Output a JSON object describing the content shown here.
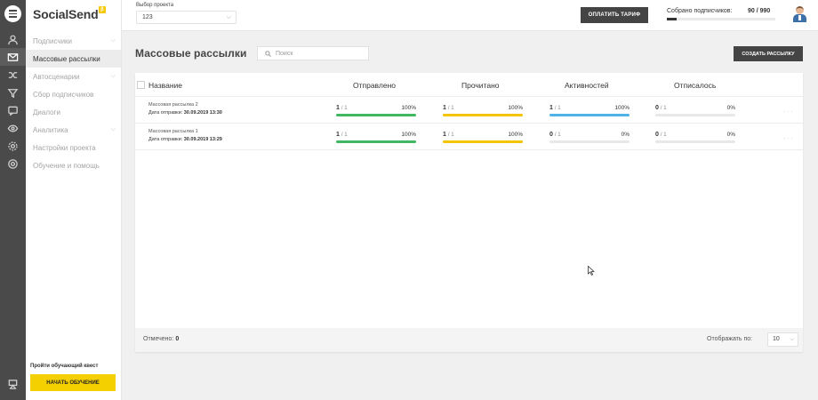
{
  "app": {
    "logo": "SocialSend",
    "logo_badge": "β"
  },
  "rail_icons": [
    "menu-icon",
    "users-icon",
    "mail-icon",
    "shuffle-icon",
    "funnel-icon",
    "chat-icon",
    "eye-icon",
    "gear-icon",
    "help-icon",
    "graduation-icon"
  ],
  "sidebar": {
    "items": [
      {
        "label": "Подписчики",
        "expandable": true
      },
      {
        "label": "Массовые рассылки",
        "active": true
      },
      {
        "label": "Автосценарии",
        "expandable": true
      },
      {
        "label": "Сбор подписчиков"
      },
      {
        "label": "Диалоги"
      },
      {
        "label": "Аналитика",
        "expandable": true
      },
      {
        "label": "Настройки проекта"
      },
      {
        "label": "Обучение и помощь"
      }
    ],
    "quest_label": "Пройти обучающий квест",
    "start_label": "НАЧАТЬ ОБУЧЕНИЕ"
  },
  "header": {
    "project_label": "Выбор проекта",
    "project_value": "123",
    "pay_label": "ОПЛАТИТЬ ТАРИФ",
    "subs_label": "Собрано подписчиков:",
    "subs_count": "90 / 990",
    "subs_progress": 0.09
  },
  "page": {
    "title": "Массовые рассылки",
    "search_placeholder": "Поиск",
    "create_label": "СОЗДАТЬ РАССЫЛКУ"
  },
  "table": {
    "columns": {
      "name": "Название",
      "sent": "Отправлено",
      "read": "Прочитано",
      "activity": "Активностей",
      "unsub": "Отписалось"
    },
    "rows": [
      {
        "name": "Массовая рассылка 2",
        "date_label": "Дата отправки:",
        "date": "30.09.2019 13:30",
        "sent": {
          "value": "1",
          "of": "/ 1",
          "pct": "100%",
          "fill": 1.0
        },
        "read": {
          "value": "1",
          "of": "/ 1",
          "pct": "100%",
          "fill": 1.0
        },
        "activity": {
          "value": "1",
          "of": "/ 1",
          "pct": "100%",
          "fill": 1.0
        },
        "unsub": {
          "value": "0",
          "of": "/ 1",
          "pct": "0%",
          "fill": 0.0
        }
      },
      {
        "name": "Массовая рассылка 1",
        "date_label": "Дата отправки:",
        "date": "30.09.2019 13:29",
        "sent": {
          "value": "1",
          "of": "/ 1",
          "pct": "100%",
          "fill": 1.0
        },
        "read": {
          "value": "1",
          "of": "/ 1",
          "pct": "100%",
          "fill": 1.0
        },
        "activity": {
          "value": "0",
          "of": "/ 1",
          "pct": "0%",
          "fill": 0.0
        },
        "unsub": {
          "value": "0",
          "of": "/ 1",
          "pct": "0%",
          "fill": 0.0
        }
      }
    ],
    "row_menu": "···",
    "footer": {
      "marked_label": "Отмечено:",
      "marked_value": "0",
      "show_label": "Отображать по:",
      "per_page": "10"
    }
  },
  "colors": {
    "sent": "#3fb861",
    "read": "#f5c400",
    "activity": "#4fb3e8",
    "unsub": "#9e9e9e"
  }
}
